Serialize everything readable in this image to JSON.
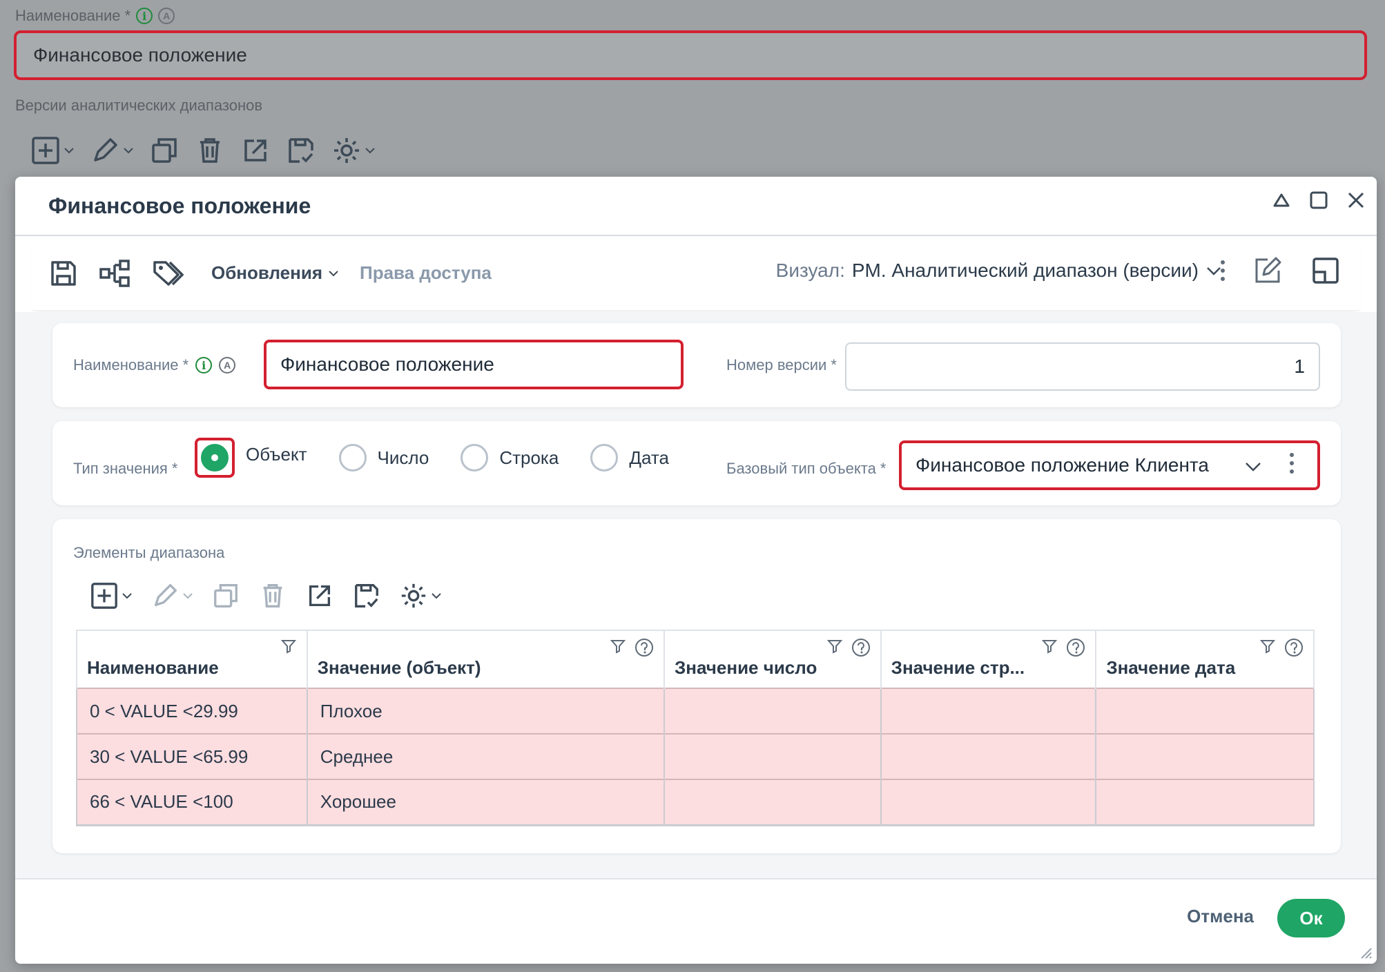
{
  "background": {
    "name_label": "Наименование *",
    "name_value": "Финансовое положение",
    "versions_label": "Версии аналитических диапазонов"
  },
  "dialog": {
    "title": "Финансовое положение",
    "toolbar": {
      "updates_label": "Обновления",
      "access_label": "Права доступа",
      "visual_label": "Визуал:",
      "visual_value": "PM. Аналитический диапазон (версии)"
    },
    "form": {
      "name_label": "Наименование *",
      "name_value": "Финансовое положение",
      "version_label": "Номер версии *",
      "version_value": "1",
      "value_type_label": "Тип значения *",
      "value_type_options": [
        "Объект",
        "Число",
        "Строка",
        "Дата"
      ],
      "value_type_selected": "Объект",
      "base_type_label": "Базовый тип объекта *",
      "base_type_value": "Финансовое положение Клиента"
    },
    "range": {
      "section_label": "Элементы диапазона",
      "columns": [
        "Наименование",
        "Значение (объект)",
        "Значение число",
        "Значение стр...",
        "Значение дата"
      ],
      "rows": [
        [
          "0 < VALUE <29.99",
          "Плохое",
          "",
          "",
          ""
        ],
        [
          "30 < VALUE <65.99",
          "Среднее",
          "",
          "",
          ""
        ],
        [
          "66 < VALUE <100",
          "Хорошее",
          "",
          "",
          ""
        ]
      ]
    },
    "footer": {
      "cancel_label": "Отмена",
      "ok_label": "Ок"
    }
  },
  "colors": {
    "accent": "#1fa566",
    "highlight": "#d32030",
    "row_highlight": "#fcdde0"
  }
}
